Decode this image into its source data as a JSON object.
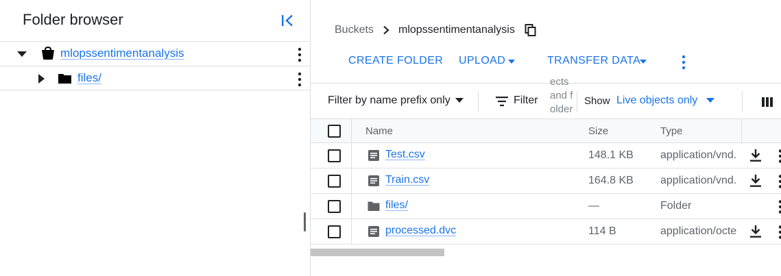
{
  "folder_browser": {
    "title": "Folder browser",
    "tree": [
      {
        "label": "mlopssentimentanalysis",
        "icon": "bucket-icon",
        "expanded": true
      },
      {
        "label": "files/",
        "icon": "folder-icon",
        "expanded": false
      }
    ]
  },
  "breadcrumb": {
    "root": "Buckets",
    "current": "mlopssentimentanalysis"
  },
  "toolbar": {
    "create_folder": "CREATE FOLDER",
    "upload": "UPLOAD",
    "transfer_data": "TRANSFER DATA"
  },
  "filter_bar": {
    "prefix_filter": "Filter by name prefix only",
    "filter_label": "Filter",
    "overflow_text": "ects and folders",
    "show_label": "Show",
    "show_value": "Live objects only"
  },
  "table": {
    "columns": [
      "Name",
      "Size",
      "Type"
    ],
    "rows": [
      {
        "name": "Test.csv",
        "size": "148.1 KB",
        "type": "application/vnd.",
        "icon": "document-icon",
        "downloadable": true
      },
      {
        "name": "Train.csv",
        "size": "164.8 KB",
        "type": "application/vnd.",
        "icon": "document-icon",
        "downloadable": true
      },
      {
        "name": "files/",
        "size": "—",
        "type": "Folder",
        "icon": "folder-icon",
        "downloadable": false
      },
      {
        "name": "processed.dvc",
        "size": "114 B",
        "type": "application/octe",
        "icon": "document-icon",
        "downloadable": true
      }
    ]
  },
  "colors": {
    "accent": "#1a73e8",
    "text": "#202124",
    "muted": "#5f6368",
    "border": "#dadce0"
  }
}
